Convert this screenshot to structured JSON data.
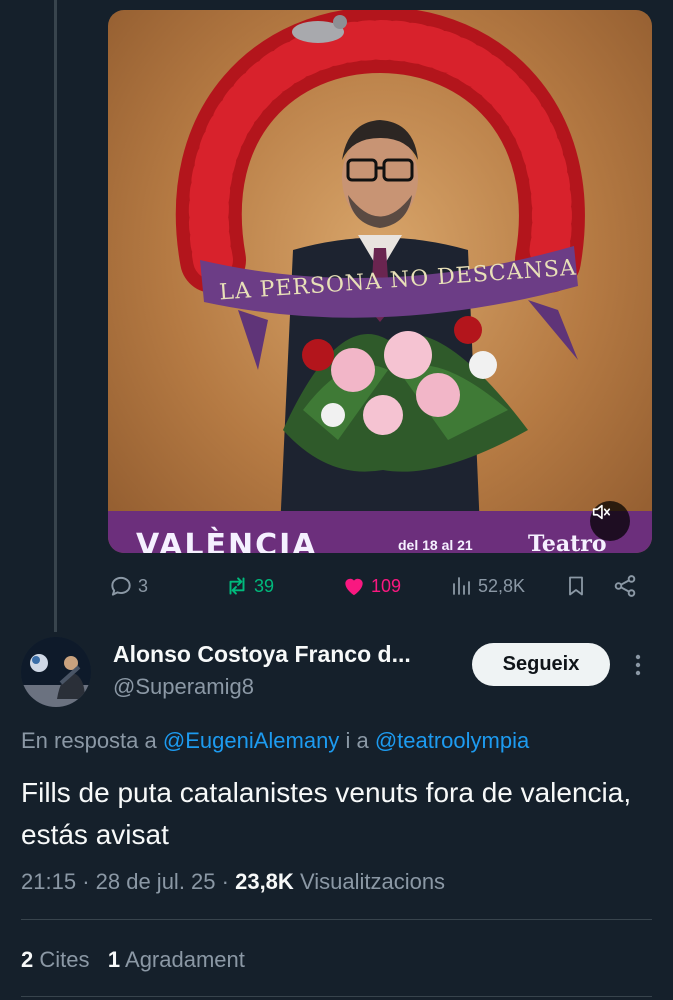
{
  "media": {
    "banner_text": "LA PERSONA NO DESCANSA",
    "poster_city": "VALÈNCIA",
    "poster_dates": "del 18 al 21",
    "poster_venue": "Teatro"
  },
  "actions": {
    "replies": "3",
    "retweets": "39",
    "likes": "109",
    "views": "52,8K"
  },
  "reply_tweet": {
    "author_name": "Alonso Costoya Franco d...",
    "author_handle": "@Superamig8",
    "follow_label": "Segueix",
    "reply_prefix": "En resposta a",
    "mention_1": "@EugeniAlemany",
    "reply_joiner": "i a",
    "mention_2": "@teatroolympia",
    "text": "Fills de puta catalanistes venuts fora de valencia, estás avisat",
    "time": "21:15",
    "date": "28 de jul. 25",
    "views_count": "23,8K",
    "views_label": "Visualitzacions",
    "quotes_count": "2",
    "quotes_label": "Cites",
    "likes_count": "1",
    "likes_label": "Agradament"
  },
  "colors": {
    "background": "#15202b",
    "retweet_green": "#00ba7c",
    "like_pink": "#f91880",
    "link_blue": "#1d9bf0",
    "secondary_text": "#8b98a5"
  }
}
